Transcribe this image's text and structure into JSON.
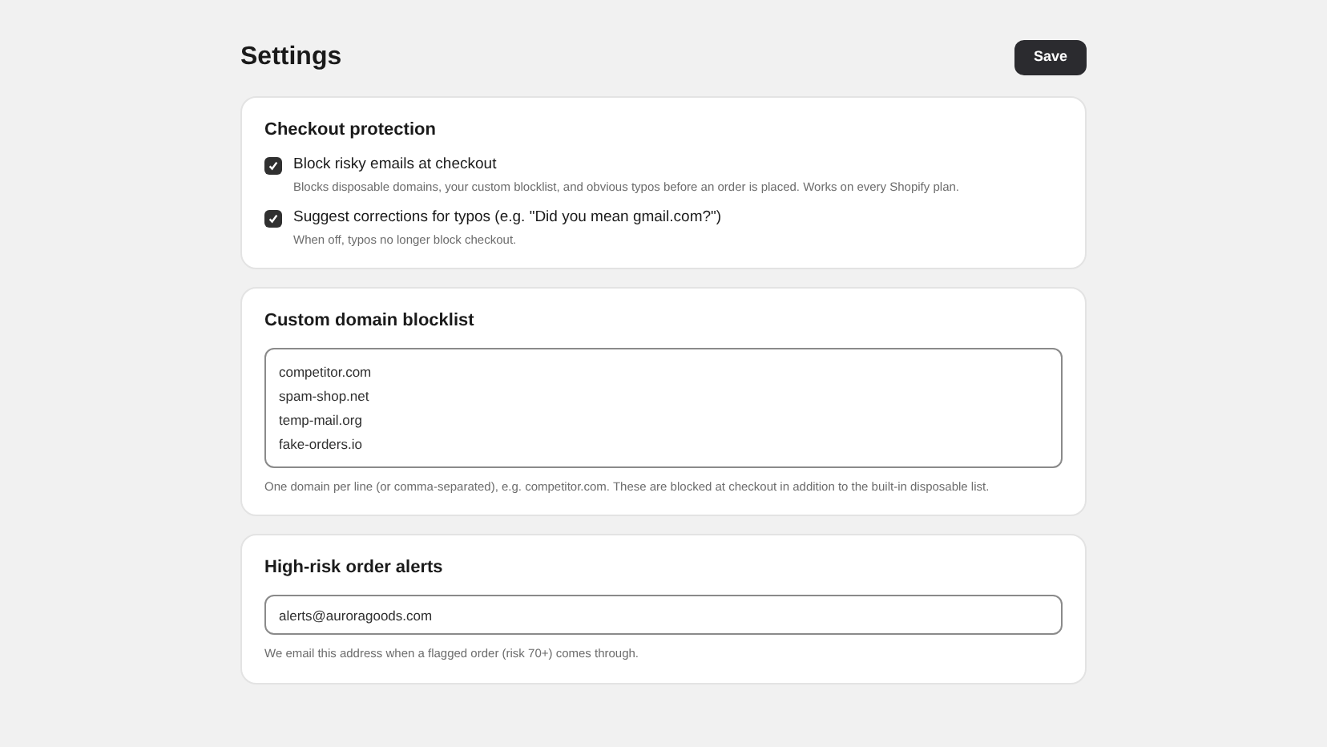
{
  "page": {
    "title": "Settings",
    "save_button": "Save"
  },
  "checkout_protection": {
    "heading": "Checkout protection",
    "options": [
      {
        "label": "Block risky emails at checkout",
        "description": "Blocks disposable domains, your custom blocklist, and obvious typos before an order is placed. Works on every Shopify plan.",
        "checked": true
      },
      {
        "label": "Suggest corrections for typos (e.g. \"Did you mean gmail.com?\")",
        "description": "When off, typos no longer block checkout.",
        "checked": true
      }
    ]
  },
  "blocklist": {
    "heading": "Custom domain blocklist",
    "domains": [
      "competitor.com",
      "spam-shop.net",
      "temp-mail.org",
      "fake-orders.io"
    ],
    "help": "One domain per line (or comma-separated), e.g. competitor.com. These are blocked at checkout in addition to the built-in disposable list."
  },
  "alerts": {
    "heading": "High-risk order alerts",
    "email": "alerts@auroragoods.com",
    "help": "We email this address when a flagged order (risk 70+) comes through."
  }
}
